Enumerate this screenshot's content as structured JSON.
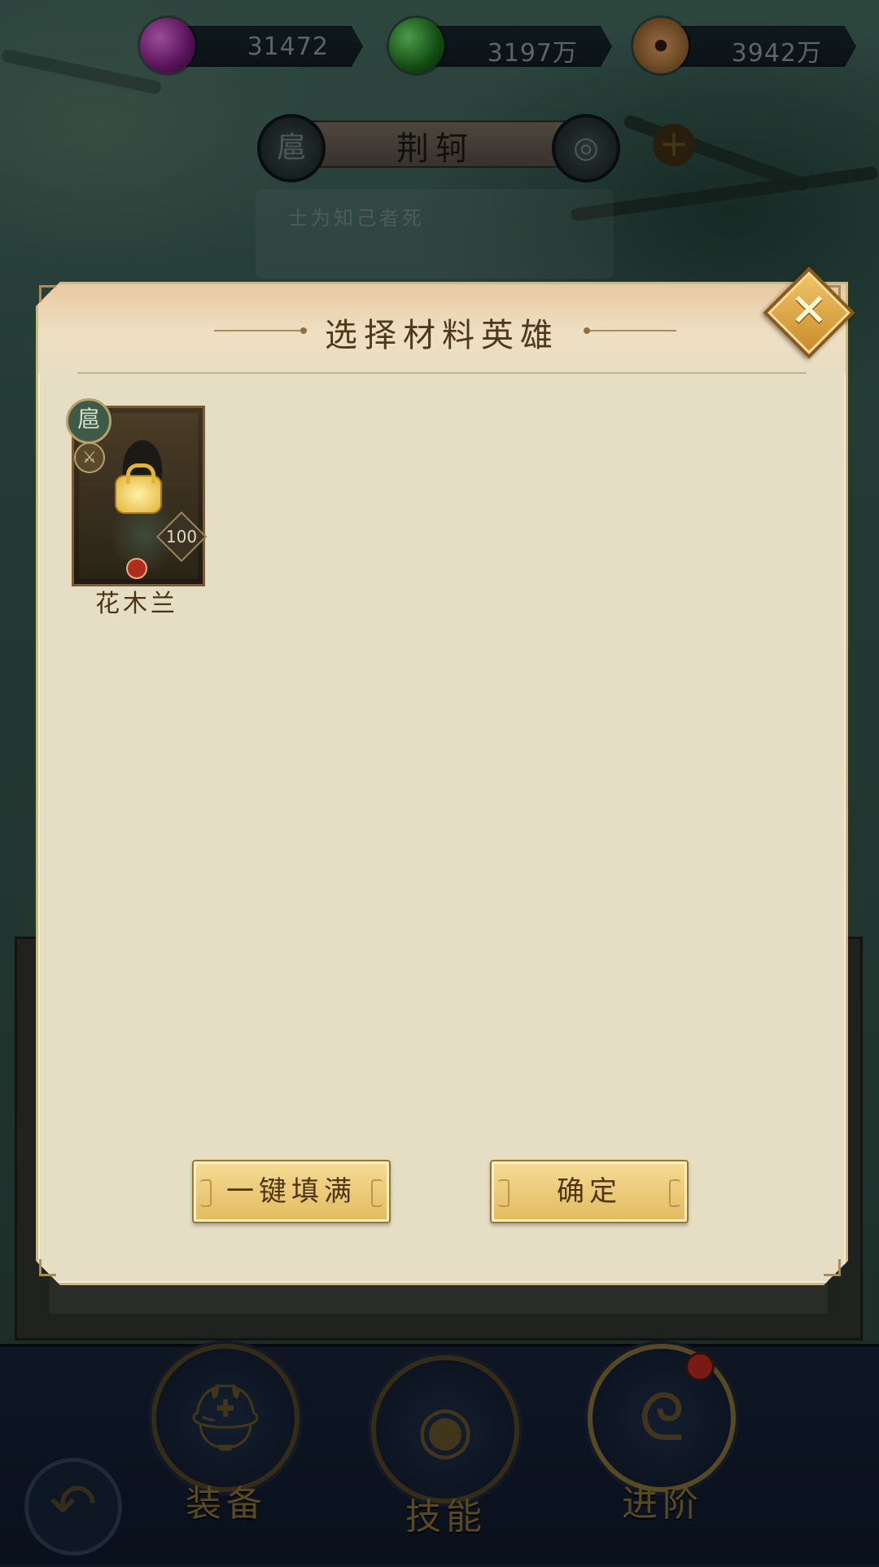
{
  "currency": [
    {
      "icon": "purple-gem-icon",
      "value": "31472",
      "color": "#8a2a8a"
    },
    {
      "icon": "green-jade-icon",
      "value": "3197万",
      "color": "#2a7a2a"
    },
    {
      "icon": "copper-coin-icon",
      "value": "3942万",
      "color": "#9a6a3a"
    }
  ],
  "hero_header": {
    "name": "荆轲",
    "faction_glyph": "扈",
    "motto": "士为知己者死"
  },
  "modal": {
    "title": "选择材料英雄",
    "close_label": "✕",
    "heroes": [
      {
        "name": "花木兰",
        "level": "100",
        "faction_glyph": "扈",
        "locked": true
      }
    ],
    "buttons": {
      "fill_all": "一键填满",
      "confirm": "确定"
    }
  },
  "bottom_nav": [
    {
      "label": "装备",
      "icon": "helmet-icon"
    },
    {
      "label": "技能",
      "icon": "skill-swirl-icon"
    },
    {
      "label": "进阶",
      "icon": "dragon-advance-icon"
    }
  ],
  "back_icon": "back-arrow-icon"
}
